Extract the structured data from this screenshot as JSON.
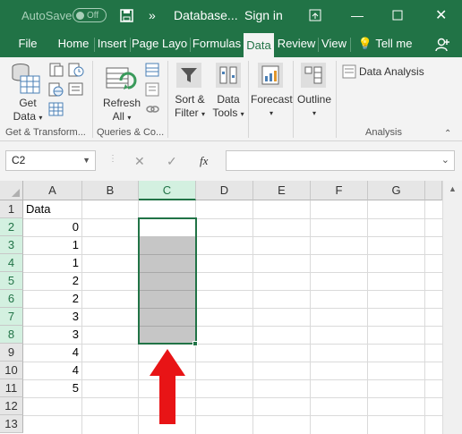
{
  "titlebar": {
    "autosave_label": "AutoSave",
    "autosave_state": "Off",
    "filename": "Database...",
    "signin": "Sign in"
  },
  "tabs": [
    "File",
    "Home",
    "Insert",
    "Page Layout",
    "Formulas",
    "Data",
    "Review",
    "View"
  ],
  "active_tab": "Data",
  "tell_me": "Tell me",
  "ribbon": {
    "get_data_1": "Get",
    "get_data_2": "Data",
    "refresh_1": "Refresh",
    "refresh_2": "All",
    "sort_1": "Sort &",
    "sort_2": "Filter",
    "tools_1": "Data",
    "tools_2": "Tools",
    "forecast": "Forecast",
    "outline": "Outline",
    "analysis": "Data Analysis",
    "group_get": "Get & Transform...",
    "group_queries": "Queries & Co...",
    "group_analysis": "Analysis"
  },
  "formula_bar": {
    "name_box": "C2",
    "fx": "fx",
    "formula": ""
  },
  "columns": [
    "A",
    "B",
    "C",
    "D",
    "E",
    "F",
    "G"
  ],
  "selected_column": "C",
  "rows": [
    "1",
    "2",
    "3",
    "4",
    "5",
    "6",
    "7",
    "8",
    "9",
    "10",
    "11",
    "12",
    "13"
  ],
  "column_a": [
    "Data",
    "0",
    "1",
    "1",
    "2",
    "2",
    "3",
    "3",
    "4",
    "4",
    "5",
    "",
    ""
  ],
  "annotation": {
    "arrow_color": "#e81416"
  },
  "colors": {
    "accent": "#217346"
  }
}
